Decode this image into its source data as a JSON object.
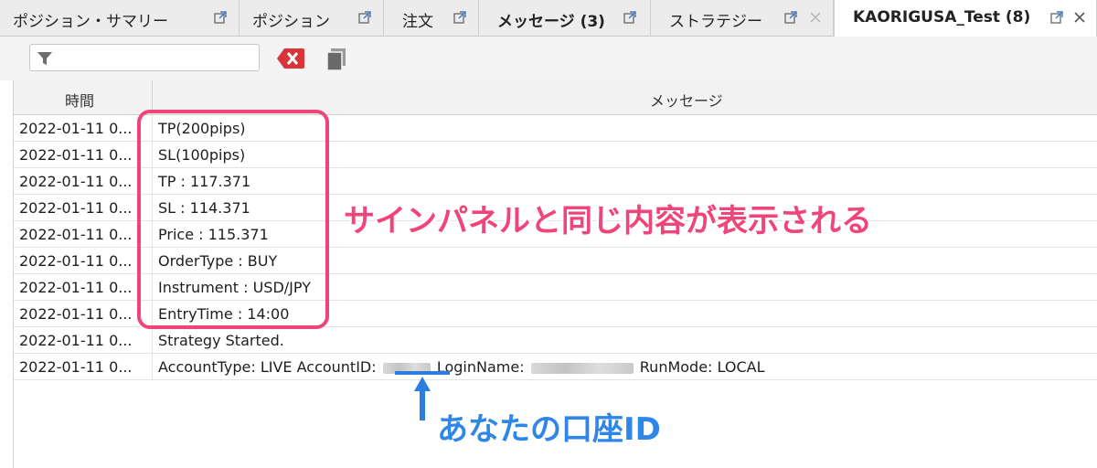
{
  "tabs": [
    {
      "label": "ポジション・サマリー",
      "bold": false,
      "active": false,
      "closable": false
    },
    {
      "label": "ポジション",
      "bold": false,
      "active": false,
      "closable": false
    },
    {
      "label": "注文",
      "bold": false,
      "active": false,
      "closable": false
    },
    {
      "label": "メッセージ (3)",
      "bold": true,
      "active": false,
      "closable": false
    },
    {
      "label": "ストラテジー",
      "bold": false,
      "active": false,
      "closable": true
    },
    {
      "label": "KAORIGUSA_Test (8)",
      "bold": true,
      "active": true,
      "closable": true
    }
  ],
  "toolbar": {
    "filter_value": "",
    "filter_icon": "funnel-icon",
    "clear_icon": "clear-filter-icon",
    "copy_icon": "copy-icon"
  },
  "table": {
    "columns": [
      "時間",
      "メッセージ"
    ],
    "rows": [
      {
        "time": "2022-01-11 0...",
        "message": "TP(200pips)"
      },
      {
        "time": "2022-01-11 0...",
        "message": "SL(100pips)"
      },
      {
        "time": "2022-01-11 0...",
        "message": "TP : 117.371"
      },
      {
        "time": "2022-01-11 0...",
        "message": "SL : 114.371"
      },
      {
        "time": "2022-01-11 0...",
        "message": "Price : 115.371"
      },
      {
        "time": "2022-01-11 0...",
        "message": "OrderType : BUY"
      },
      {
        "time": "2022-01-11 0...",
        "message": "Instrument : USD/JPY"
      },
      {
        "time": "2022-01-11 0...",
        "message": "EntryTime : 14:00"
      },
      {
        "time": "2022-01-11 0...",
        "message": "Strategy Started."
      }
    ],
    "account_row": {
      "time": "2022-01-11 0...",
      "prefix": "AccountType: LIVE AccountID:",
      "login_label": "LoginName:",
      "run_mode": "RunMode: LOCAL"
    }
  },
  "annotations": {
    "pink_callout": "サインパネルと同じ内容が表示される",
    "blue_callout": "あなたの口座ID"
  },
  "colors": {
    "accent_pink": "#f0457a",
    "accent_blue": "#2f86e8",
    "clear_red": "#d9343a"
  }
}
